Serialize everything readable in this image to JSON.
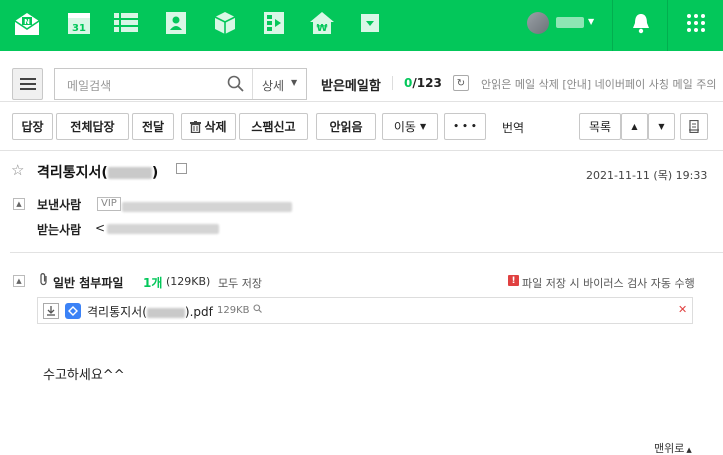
{
  "topbar": {
    "calendar_day": "31",
    "won_symbol": "₩",
    "bg_color": "#03c75a"
  },
  "toolbar": {
    "search_placeholder": "메일검색",
    "search_detail": "상세",
    "folder_name": "받은메일함",
    "unread_count": "0",
    "total_count": "/123",
    "notice": "안읽은 메일 삭제 [안내] 네이버페이 사칭 메일 주의",
    "reply": "답장",
    "reply_all": "전체답장",
    "forward": "전달",
    "delete": "삭제",
    "spam": "스팸신고",
    "mark_unread": "안읽음",
    "move": "이동",
    "more": "• • •",
    "translate": "번역",
    "list": "목록"
  },
  "mail": {
    "subject_prefix": "격리통지서(",
    "subject_suffix": ")",
    "date": "2021-11-11 (목) 19:33",
    "sender_label": "보낸사람",
    "vip": "VIP",
    "recipient_label": "받는사람",
    "recipient_prefix": "<"
  },
  "attachments": {
    "title": "일반 첨부파일",
    "count": "1개",
    "size": "(129KB)",
    "save_all": "모두 저장",
    "warning": "파일 저장 시 바이러스 검사 자동 수행",
    "file_prefix": "격리통지서(",
    "file_suffix": ").pdf",
    "file_size": "129KB"
  },
  "body": {
    "text": "수고하세요^^",
    "to_top": "맨위로"
  }
}
